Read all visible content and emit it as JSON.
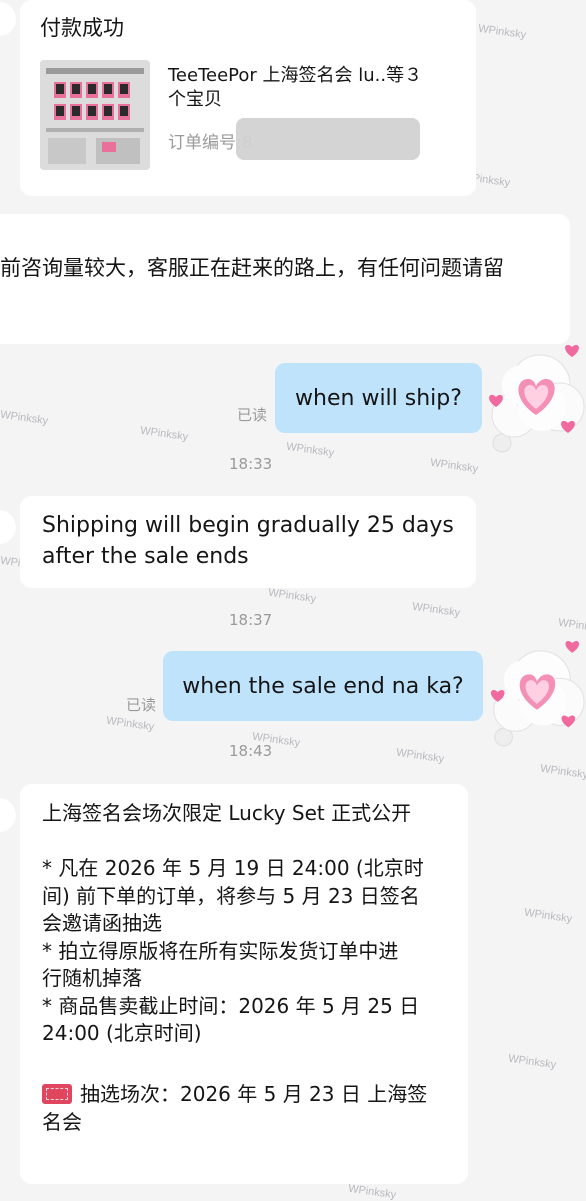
{
  "payment_card": {
    "title": "付款成功",
    "product_title_line1": "TeeTeePor 上海签名会 lu..等３",
    "product_title_line2": "个宝贝",
    "order_label": "订单编号:8"
  },
  "system_notice": "前咨询量较大，客服正在赶来的路上，有任何问题请留",
  "messages": [
    {
      "side": "right",
      "text": "when will ship?",
      "status": "已读",
      "time": "18:33"
    },
    {
      "side": "left",
      "lines": [
        "Shipping will begin gradually 25 days",
        "after the sale ends"
      ],
      "time": "18:37"
    },
    {
      "side": "right",
      "text": "when the sale end na ka?",
      "status": "已读",
      "time": "18:43"
    }
  ],
  "announcement": {
    "lines": [
      "上海签名会场次限定 Lucky Set 正式公开",
      "",
      "* 凡在 2026 年 5 月 19 日 24:00 (北京时",
      "间) 前下单的订单，将参与 5 月 23 日签名",
      "会邀请函抽选",
      "* 拍立得原版将在所有实际发货订单中进",
      "行随机掉落",
      "* 商品售卖截止时间：2026 年 5 月 25 日",
      "24:00 (北京时间)",
      ""
    ],
    "ticket_line1": "抽选场次：2026 年 5 月 23 日 上海签",
    "ticket_line2": "名会"
  },
  "watermark_text": "WPinksky",
  "icons": {
    "avatar": "heart-cloud-icon",
    "ticket": "ticket-icon"
  },
  "colors": {
    "background": "#f4f4f4",
    "outgoing_bubble": "#bfe3fb",
    "incoming_bubble": "#ffffff",
    "meta_text": "#9a9a9a"
  }
}
